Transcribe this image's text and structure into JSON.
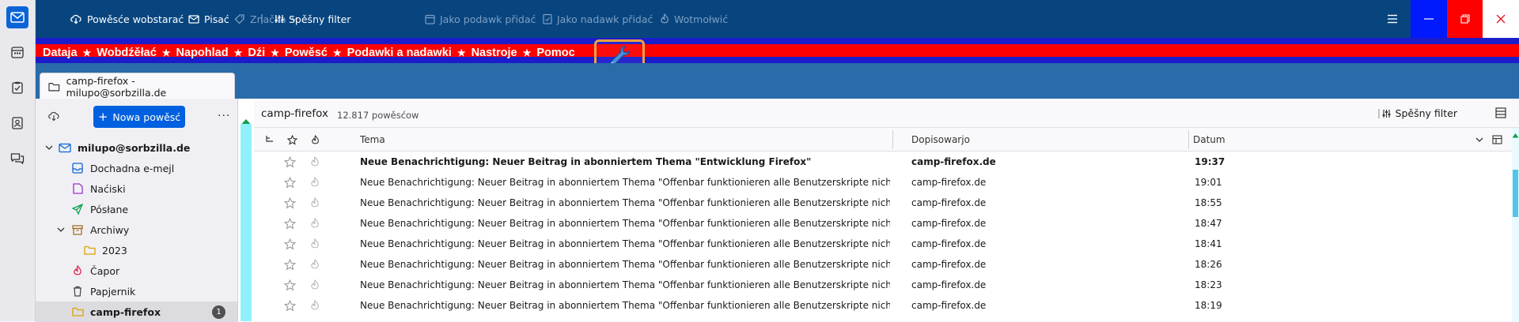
{
  "toolbar": {
    "get_messages": "Powěsće wobstarać",
    "write": "Pisać",
    "tag": "Značka",
    "quick_filter": "Spěšny filter",
    "junk": "Jako podawk přidać",
    "not_junk": "Jako nadawk přidać",
    "undo": "Wotmołwić"
  },
  "menubar": {
    "items": [
      "Dataja",
      "Wobdźěłać",
      "Napohlad",
      "Dźi",
      "Powěsć",
      "Podawki a nadawki",
      "Nastroje",
      "Pomoc"
    ],
    "separator": "★"
  },
  "tab": {
    "title": "camp-firefox - milupo@sorbzilla.de"
  },
  "folder_pane": {
    "new_message": "Nowa powěsć",
    "more": "···",
    "folders": [
      {
        "label": "milupo@sorbzilla.de",
        "icon": "account-icon"
      },
      {
        "label": "Dochadna e-mejl",
        "icon": "inbox-icon"
      },
      {
        "label": "Naćiski",
        "icon": "drafts-icon"
      },
      {
        "label": "Pósłane",
        "icon": "sent-icon"
      },
      {
        "label": "Archiwy",
        "icon": "archive-icon"
      },
      {
        "label": "2023",
        "icon": "folder-icon"
      },
      {
        "label": "Čapor",
        "icon": "junk-icon"
      },
      {
        "label": "Papjernik",
        "icon": "trash-icon"
      },
      {
        "label": "camp-firefox",
        "icon": "folder-icon",
        "badge": "1"
      }
    ]
  },
  "thread_pane": {
    "folder_name": "camp-firefox",
    "count": "12.817 powěsćow",
    "quick_filter": "Spěšny filter",
    "columns": {
      "subject": "Tema",
      "correspondent": "Dopisowarjo",
      "date": "Datum"
    },
    "rows": [
      {
        "subject": "Neue Benachrichtigung: Neuer Beitrag in abonniertem Thema \"Entwicklung Firefox\"",
        "from": "camp-firefox.de",
        "date": "19:37",
        "unread": true
      },
      {
        "subject": "Neue Benachrichtigung: Neuer Beitrag in abonniertem Thema \"Offenbar funktionieren alle Benutzerskripte nicht mehr im Nig...",
        "from": "camp-firefox.de",
        "date": "19:01",
        "unread": false
      },
      {
        "subject": "Neue Benachrichtigung: Neuer Beitrag in abonniertem Thema \"Offenbar funktionieren alle Benutzerskripte nicht mehr im Nig...",
        "from": "camp-firefox.de",
        "date": "18:55",
        "unread": false
      },
      {
        "subject": "Neue Benachrichtigung: Neuer Beitrag in abonniertem Thema \"Offenbar funktionieren alle Benutzerskripte nicht mehr im Nig...",
        "from": "camp-firefox.de",
        "date": "18:47",
        "unread": false
      },
      {
        "subject": "Neue Benachrichtigung: Neuer Beitrag in abonniertem Thema \"Offenbar funktionieren alle Benutzerskripte nicht mehr im Nig...",
        "from": "camp-firefox.de",
        "date": "18:41",
        "unread": false
      },
      {
        "subject": "Neue Benachrichtigung: Neuer Beitrag in abonniertem Thema \"Offenbar funktionieren alle Benutzerskripte nicht mehr im Nig...",
        "from": "camp-firefox.de",
        "date": "18:26",
        "unread": false
      },
      {
        "subject": "Neue Benachrichtigung: Neuer Beitrag in abonniertem Thema \"Offenbar funktionieren alle Benutzerskripte nicht mehr im Nig...",
        "from": "camp-firefox.de",
        "date": "18:23",
        "unread": false
      },
      {
        "subject": "Neue Benachrichtigung: Neuer Beitrag in abonniertem Thema \"Offenbar funktionieren alle Benutzerskripte nicht mehr im Nig...",
        "from": "camp-firefox.de",
        "date": "18:19",
        "unread": false
      }
    ]
  },
  "colors": {
    "toolbar": "#08457f",
    "menubar_red": "#ff0000",
    "menubar_blue": "#1b1dcb",
    "accent": "#0060df",
    "tabbar": "#2a6ba9"
  }
}
